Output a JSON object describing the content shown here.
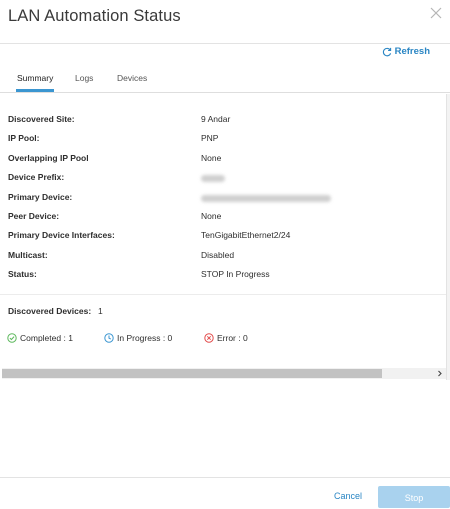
{
  "dialog": {
    "title": "LAN Automation Status",
    "refresh_label": "Refresh"
  },
  "tabs": [
    {
      "label": "Summary",
      "active": true
    },
    {
      "label": "Logs",
      "active": false
    },
    {
      "label": "Devices",
      "active": false
    }
  ],
  "details": [
    {
      "label": "Discovered Site:",
      "value": "9 Andar"
    },
    {
      "label": "IP Pool:",
      "value": "PNP"
    },
    {
      "label": "Overlapping IP Pool",
      "value": "None"
    },
    {
      "label": "Device Prefix:",
      "value": ""
    },
    {
      "label": "Primary Device:",
      "value": ""
    },
    {
      "label": "Peer Device:",
      "value": "None"
    },
    {
      "label": "Primary Device Interfaces:",
      "value": "TenGigabitEthernet2/24"
    },
    {
      "label": "Multicast:",
      "value": "Disabled"
    },
    {
      "label": "Status:",
      "value": "STOP In Progress"
    }
  ],
  "summary": {
    "discovered_label": "Discovered Devices:",
    "discovered_count": "1",
    "completed": "Completed : 1",
    "in_progress": "In Progress : 0",
    "error": "Error : 0"
  },
  "footer": {
    "cancel_label": "Cancel",
    "stop_label": "Stop"
  },
  "colors": {
    "accent": "#2a86c4",
    "tab_underline": "#3b96d1",
    "completed": "#5cb85c",
    "in_progress": "#3b96d1",
    "error": "#e24b4b",
    "stop_disabled": "#a9d2ee"
  }
}
